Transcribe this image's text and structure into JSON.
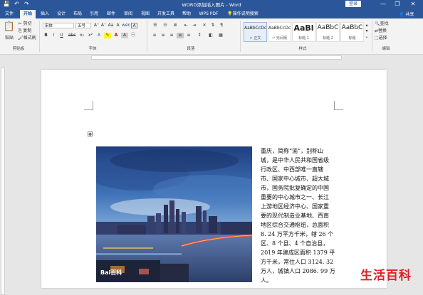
{
  "window": {
    "title": "WORD添加插入图片 - Word",
    "login_label": "登录",
    "minimize": "—",
    "restore": "❐",
    "close": "✕",
    "quick_access": {
      "save": "💾",
      "undo": "↶",
      "redo": "↷"
    }
  },
  "tabs": [
    "文件",
    "开始",
    "插入",
    "设计",
    "布局",
    "引用",
    "邮件",
    "审阅",
    "视图",
    "开发工具",
    "帮助",
    "WPS PDF"
  ],
  "active_tab": "开始",
  "tell_me": "操作说明搜索",
  "share": "共享",
  "ribbon": {
    "clipboard": {
      "paste": "粘贴",
      "cut": "剪切",
      "copy": "复制",
      "format_painter": "格式刷",
      "label": "剪贴板"
    },
    "font": {
      "name": "宋体",
      "size": "五号",
      "grow": "A⁺",
      "shrink": "A⁻",
      "case": "Aa",
      "clear": "A",
      "wen": "wén",
      "char_border": "A",
      "bold": "B",
      "italic": "I",
      "underline": "U",
      "strike": "abc",
      "sub": "x₂",
      "sup": "x²",
      "label": "字体"
    },
    "paragraph": {
      "label": "段落"
    },
    "styles": {
      "label": "样式",
      "items": [
        {
          "preview": "AaBbCcDc",
          "name": "↵ 正文"
        },
        {
          "preview": "AaBbCcDc",
          "name": "↵ 无间隔"
        },
        {
          "preview": "AaBl",
          "name": "标题 1"
        },
        {
          "preview": "AaBbC",
          "name": "标题 2"
        },
        {
          "preview": "AaBbC",
          "name": "标题"
        }
      ]
    },
    "editing": {
      "find": "查找",
      "replace": "替换",
      "select": "选择",
      "label": "编辑"
    }
  },
  "document": {
    "image_caption": "Bai百科",
    "lines": [
      "重庆，简称“渝”，别称山",
      "城，是中华人民共和国省级",
      "行政区、中西部唯一直辖",
      "市、国家中心城市、超大城",
      "市，国务院批复确定的中国",
      "重要的中心城市之一、长江",
      "上游地区经济中心、国家重",
      "要的现代制造业基地、西南",
      "地区综合交通枢纽，总面积",
      "8. 24 万平方千米，辖 26 个",
      "区、8 个县、4 个自治县，",
      "2019 年建成区面积 1379 平",
      "方千米，常住人口 3124. 32",
      "万人，城镇人口 2086. 99 万",
      "人。"
    ]
  },
  "watermark": "生活百科",
  "colors": {
    "accent": "#2b579a",
    "ribbon": "#f3f3f3",
    "watermark": "#e0202a"
  }
}
